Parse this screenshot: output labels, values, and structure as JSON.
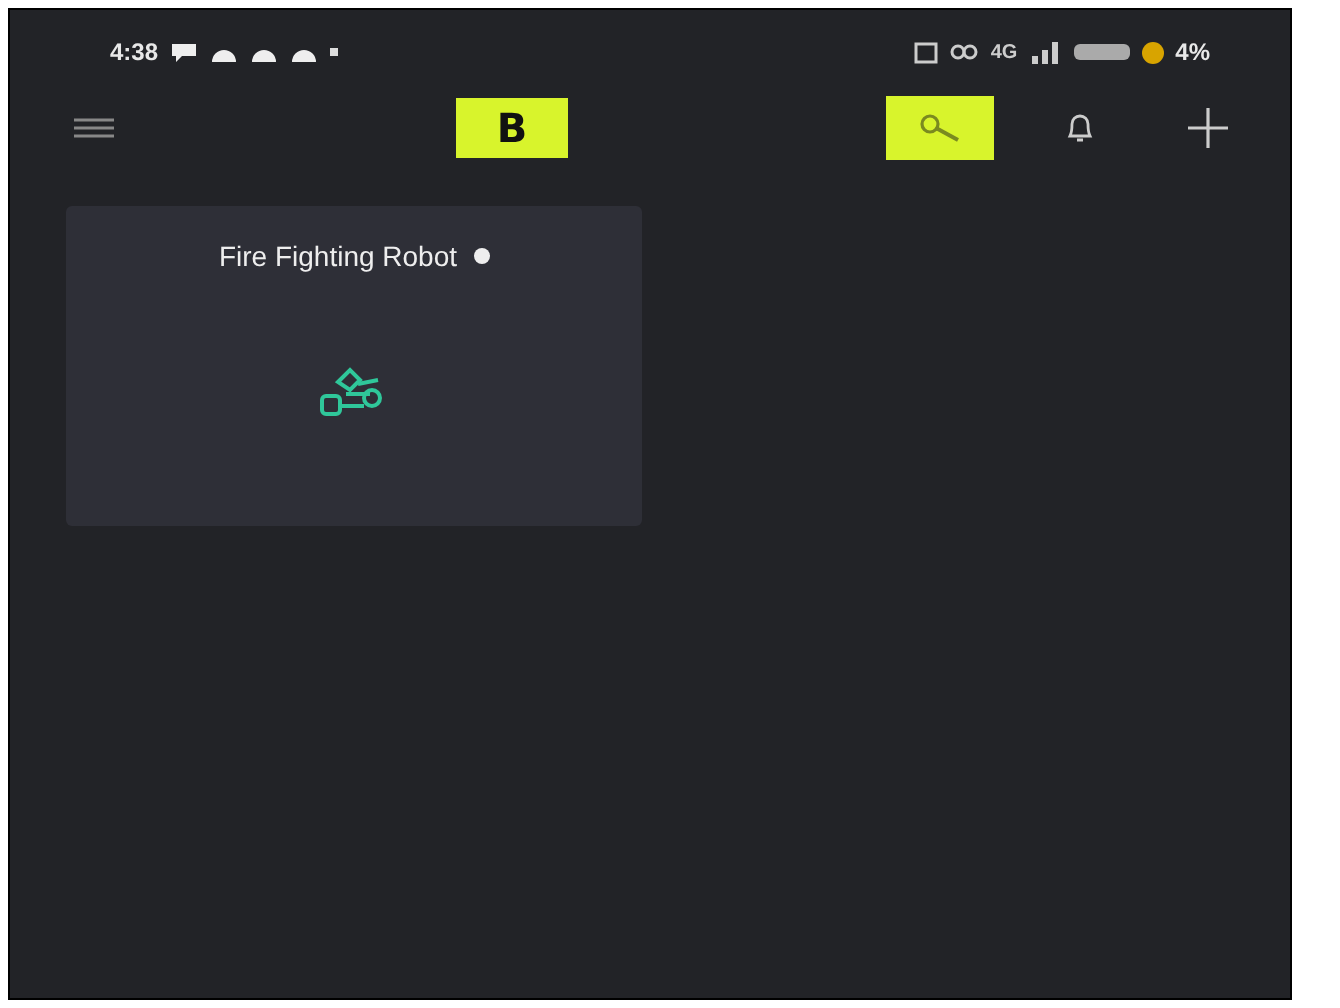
{
  "status_bar": {
    "time": "4:38",
    "network": "4G",
    "battery": "4%"
  },
  "top_bar": {
    "logo": "B",
    "developer_mode": {
      "on": true
    }
  },
  "devices": [
    {
      "name": "Fire Fighting Robot"
    }
  ]
}
